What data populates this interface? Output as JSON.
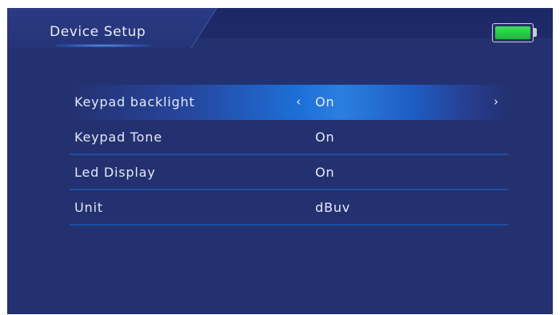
{
  "header": {
    "title": "Device Setup",
    "battery_icon": "battery-full-icon",
    "battery_color": "#2ac84a"
  },
  "menu": {
    "accent": "#1d6fd8",
    "divider_color": "#1e4fa4",
    "items": [
      {
        "label": "Keypad backlight",
        "value": "On",
        "selected": true,
        "left_icon": "chevron-left-icon",
        "right_icon": "chevron-right-icon"
      },
      {
        "label": "Keypad Tone",
        "value": "On",
        "selected": false
      },
      {
        "label": "Led Display",
        "value": "On",
        "selected": false
      },
      {
        "label": "Unit",
        "value": "dBuv",
        "selected": false
      }
    ]
  },
  "glyphs": {
    "left": "‹",
    "right": "›"
  }
}
